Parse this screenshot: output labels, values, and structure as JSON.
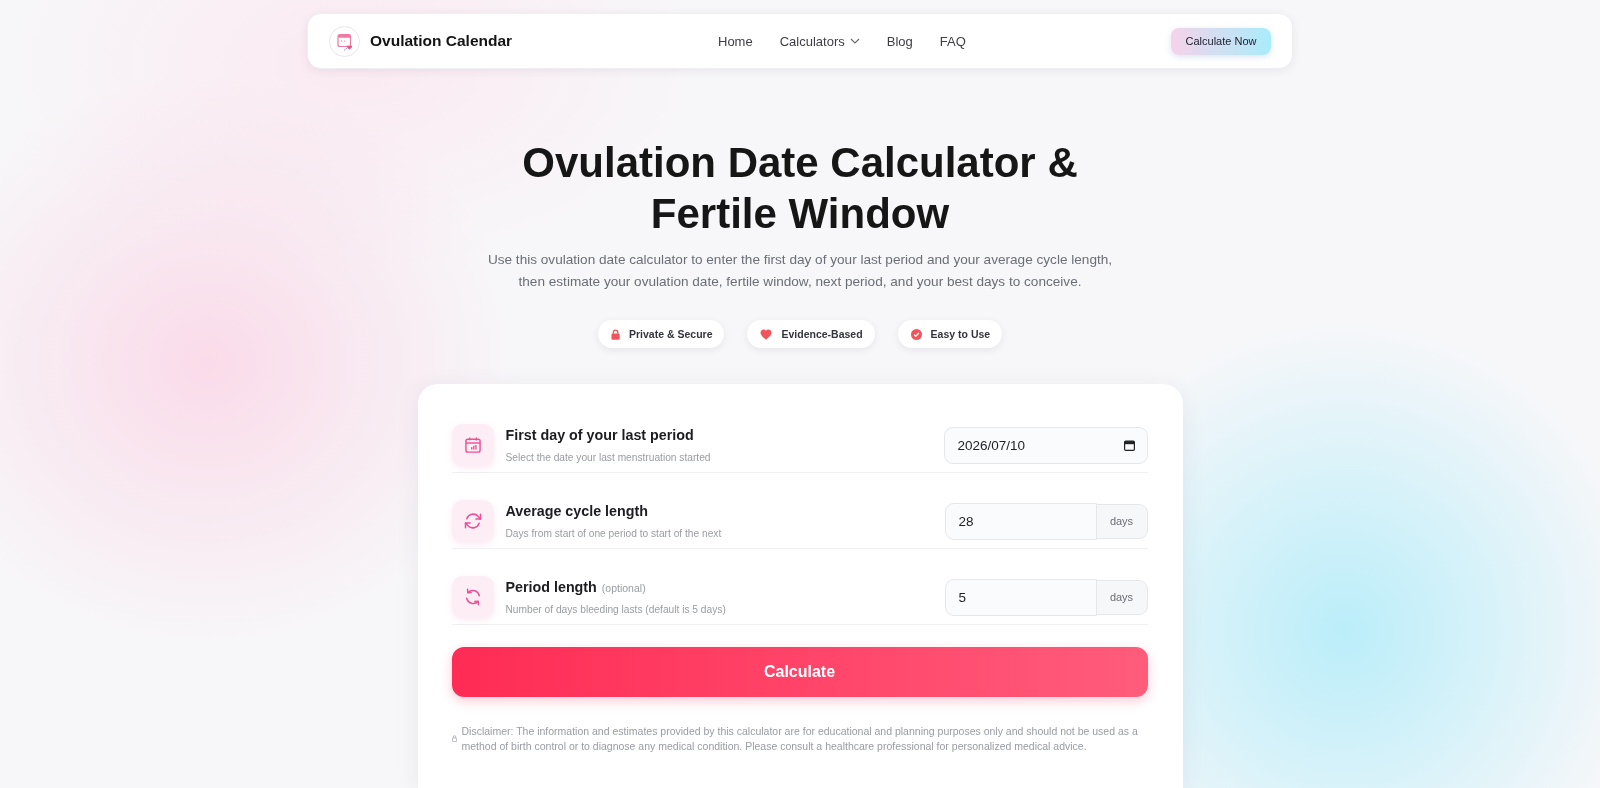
{
  "header": {
    "brand": "Ovulation Calendar",
    "nav": [
      {
        "label": "Home",
        "kind": "link"
      },
      {
        "label": "Calculators",
        "kind": "dropdown"
      },
      {
        "label": "Blog",
        "kind": "link"
      },
      {
        "label": "FAQ",
        "kind": "link"
      }
    ],
    "cta": "Calculate Now"
  },
  "hero": {
    "title": "Ovulation Date Calculator & Fertile Window",
    "subtitle": "Use this ovulation date calculator to enter the first day of your last period and your average cycle length, then estimate your ovulation date, fertile window, next period, and your best days to conceive.",
    "badges": [
      "Private & Secure",
      "Evidence-Based",
      "Easy to Use"
    ]
  },
  "form": {
    "fields": [
      {
        "kind": "date",
        "label": "First day of your last period",
        "description": "Select the date your last menstruation started",
        "value": "2026/07/10"
      },
      {
        "kind": "number",
        "label": "Average cycle length",
        "description": "Days from start of one period to start of the next",
        "value": "28",
        "unit": "days"
      },
      {
        "kind": "number",
        "label": "Period length",
        "note": "(optional)",
        "description": "Number of days bleeding lasts (default is 5 days)",
        "value": "5",
        "unit": "days"
      }
    ],
    "submit": "Calculate",
    "disclaimer": "Disclaimer: The information and estimates provided by this calculator are for educational and planning purposes only and should not be used as a method of birth control or to diagnose any medical condition. Please consult a healthcare professional for personalized medical advice."
  }
}
